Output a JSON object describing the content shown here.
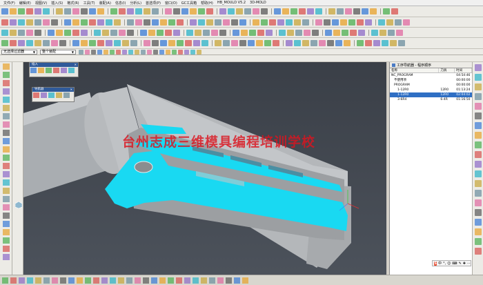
{
  "menubar": {
    "items": [
      "文件(F)",
      "编辑(E)",
      "视图(V)",
      "插入(S)",
      "格式(R)",
      "工具(T)",
      "装配(A)",
      "信息(I)",
      "分析(L)",
      "首选项(P)",
      "窗口(O)",
      "GC工具箱",
      "帮助(H)",
      "HB_MOULD V5.2",
      "3D-MOLD"
    ]
  },
  "filterbar": {
    "filter_select": "无选择过滤器",
    "scope_select": "整个装配"
  },
  "panels": {
    "insert_title": "插入",
    "nav_title": "导航器"
  },
  "watermark": "台州志成三维模具编程培训学校",
  "operation_navigator": {
    "title": "工序导航器 - 程序顺序",
    "columns": [
      "名称",
      "刀具",
      "时间"
    ],
    "rows": [
      {
        "name": "NC_PROGRAM",
        "tool": "",
        "time": "04:54:46",
        "selected": false
      },
      {
        "name": "不使用项",
        "tool": "",
        "time": "00:00:00",
        "selected": false
      },
      {
        "name": "PROGRAM",
        "tool": "",
        "time": "00:00:00",
        "selected": false
      },
      {
        "name": "1-12R0",
        "tool": "12R0",
        "time": "01:13:24",
        "selected": false
      },
      {
        "name": "1-12R0",
        "tool": "12R0",
        "time": "02:04:02",
        "selected": true
      },
      {
        "name": "3-6R4",
        "tool": "6-4R",
        "time": "01:16:50",
        "selected": false
      }
    ]
  },
  "ime": {
    "logo": "S",
    "labels": [
      "中",
      "°,",
      "☺",
      "⌨",
      "✎",
      "✚",
      "⋯"
    ]
  },
  "colors": {
    "part_gray": "#b9bcbf",
    "highlight_cyan": "#19d9f2",
    "accent_blue": "#2f6fc4",
    "watermark_red": "#dc141e"
  }
}
